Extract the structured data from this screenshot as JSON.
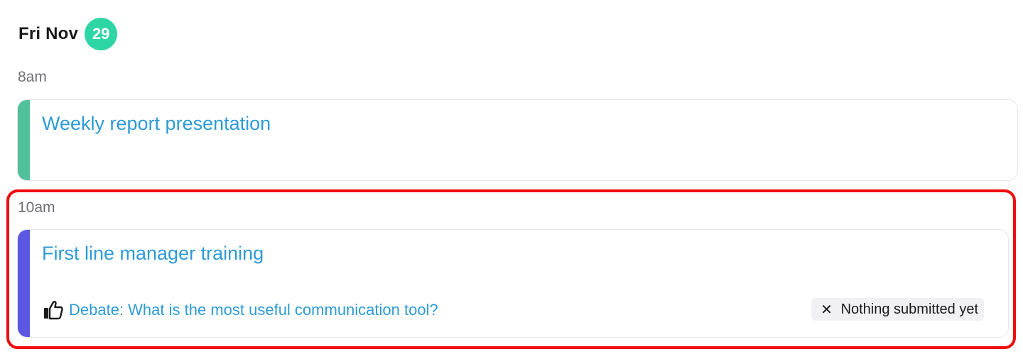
{
  "day": {
    "label": "Fri Nov",
    "date_badge": "29"
  },
  "events": [
    {
      "time": "8am",
      "title": "Weekly report presentation",
      "accent_color": "#52c19b"
    },
    {
      "time": "10am",
      "title": "First line manager training",
      "accent_color": "#5b57e3",
      "activity": {
        "icon": "thumbs-up-icon",
        "label": "Debate: What is the most useful communication tool?",
        "status_icon": "close-icon",
        "status": "Nothing submitted yet"
      }
    }
  ],
  "colors": {
    "badge": "#2ed6a5",
    "link": "#2d9bd6",
    "highlight": "#ee0d0d"
  }
}
